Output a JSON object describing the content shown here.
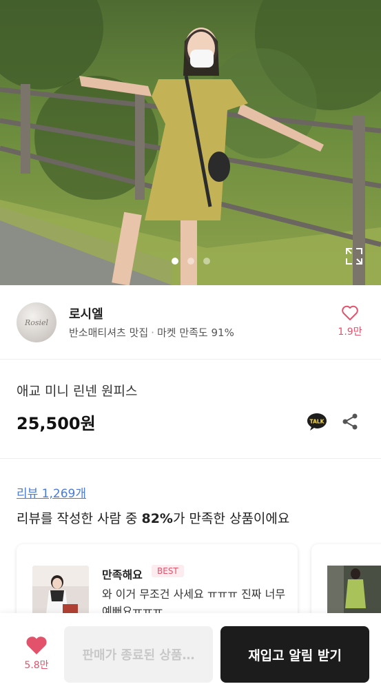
{
  "hero": {
    "image_alt": "Model wearing a yellow mini linen dress by a fence",
    "dot_count": 3,
    "active_dot": 0
  },
  "seller": {
    "avatar_text": "Rosiel",
    "name": "로시엘",
    "tagline": "반소매티셔츠 맛집",
    "satisfaction": "마켓 만족도 91%",
    "like_count": "1.9만"
  },
  "product": {
    "name": "애교 미니 린넨 원피스",
    "price": "25,500원",
    "talk_label": "TALK"
  },
  "review": {
    "link": "리뷰 1,269개",
    "summary_prefix": "리뷰를 작성한 사람 중 ",
    "summary_percent": "82%",
    "summary_suffix": "가 만족한 상품이에요",
    "card": {
      "title": "만족해요",
      "badge": "BEST",
      "text": "와 이거 무조건 사세요 ㅠㅠㅠ 진짜 너무 예뻐요ㅠㅠㅠ…"
    }
  },
  "bottom_bar": {
    "like_count": "5.8만",
    "disabled_label": "판매가 종료된 상품…",
    "primary_label": "재입고 알림 받기"
  },
  "colors": {
    "accent_pink": "#e2526b",
    "link_blue": "#4a7bd6",
    "primary_button": "#1c1c1c",
    "talk_yellow": "#3b1e1e"
  }
}
